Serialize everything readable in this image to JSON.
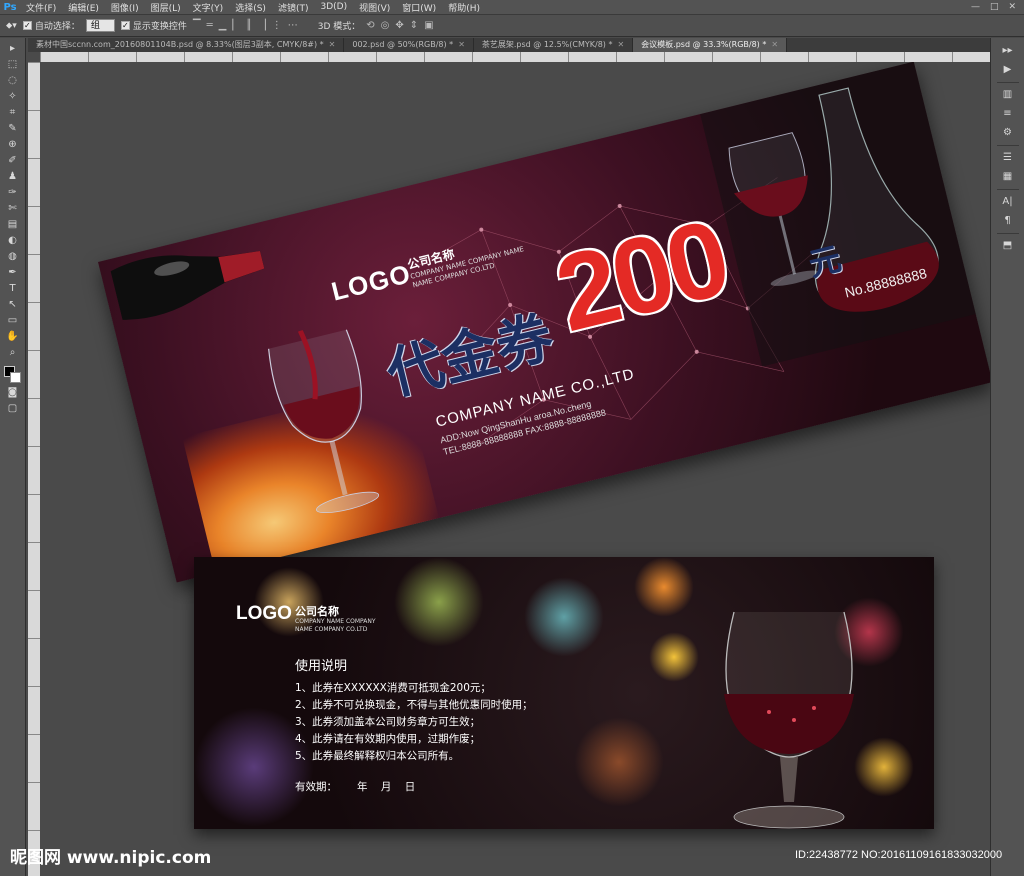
{
  "app": {
    "logo": "Ps",
    "menu": [
      "文件(F)",
      "编辑(E)",
      "图像(I)",
      "图层(L)",
      "文字(Y)",
      "选择(S)",
      "滤镜(T)",
      "3D(D)",
      "视图(V)",
      "窗口(W)",
      "帮助(H)"
    ],
    "window_controls": [
      "—",
      "□",
      "✕"
    ]
  },
  "options": {
    "auto_select_label": "自动选择：",
    "auto_select_value": "组",
    "show_transform_label": "显示变换控件",
    "mode_label": "3D 模式："
  },
  "tabs": [
    {
      "label": "素材中国sccnn.com_20160801104B.psd @ 8.33%(图层3副本, CMYK/8#) *",
      "active": false
    },
    {
      "label": "002.psd @ 50%(RGB/8) *",
      "active": false
    },
    {
      "label": "茶艺展架.psd @ 12.5%(CMYK/8) *",
      "active": false
    },
    {
      "label": "会议模板.psd @ 33.3%(RGB/8) *",
      "active": true
    }
  ],
  "tools": [
    "▸",
    "⬚",
    "◌",
    "✧",
    "⌗",
    "✎",
    "⊕",
    "✐",
    "♟",
    "✑",
    "✄",
    "▤",
    "◐",
    "◍",
    "✒",
    "T",
    "↖",
    "▭",
    "✋",
    "⌕"
  ],
  "right_icons": [
    "▸▸",
    "▶",
    "▥",
    "≡",
    "⚙",
    "☰",
    "▦",
    "A|",
    "¶",
    "⬒"
  ],
  "front": {
    "logo": "LOGO",
    "company_cn": "公司名称",
    "company_en_1": "COMPANY NAME COMPANY NAME",
    "company_en_2": "NAME COMPANY CO.LTD",
    "title": "代金券",
    "amount": "200",
    "unit": "元",
    "serial": "No.88888888",
    "company_name": "COMPANY NAME CO.,LTD",
    "address": "ADD:Now QingShanHu aroa.No.cheng",
    "tel": "TEL:8888-88888888    FAX:8888-88888888"
  },
  "back": {
    "logo": "LOGO",
    "company_cn": "公司名称",
    "company_en_1": "COMPANY NAME COMPANY",
    "company_en_2": "NAME COMPANY CO.LTD",
    "heading": "使用说明",
    "rules": [
      "1、此券在XXXXXX消费可抵现金200元；",
      "2、此券不可兑换现金，不得与其他优惠同时使用；",
      "3、此券须加盖本公司财务章方可生效；",
      "4、此券请在有效期内使用，过期作废；",
      "5、此券最终解释权归本公司所有。"
    ],
    "validity": "有效期：      年    月    日"
  },
  "watermark": {
    "left": "昵图网 www.nipic.com",
    "right": "ID:22438772 NO:20161109161833032000"
  },
  "colors": {
    "accent_red": "#e42a25",
    "title_navy": "#1c2f63",
    "card_wine": "#3d1022"
  }
}
